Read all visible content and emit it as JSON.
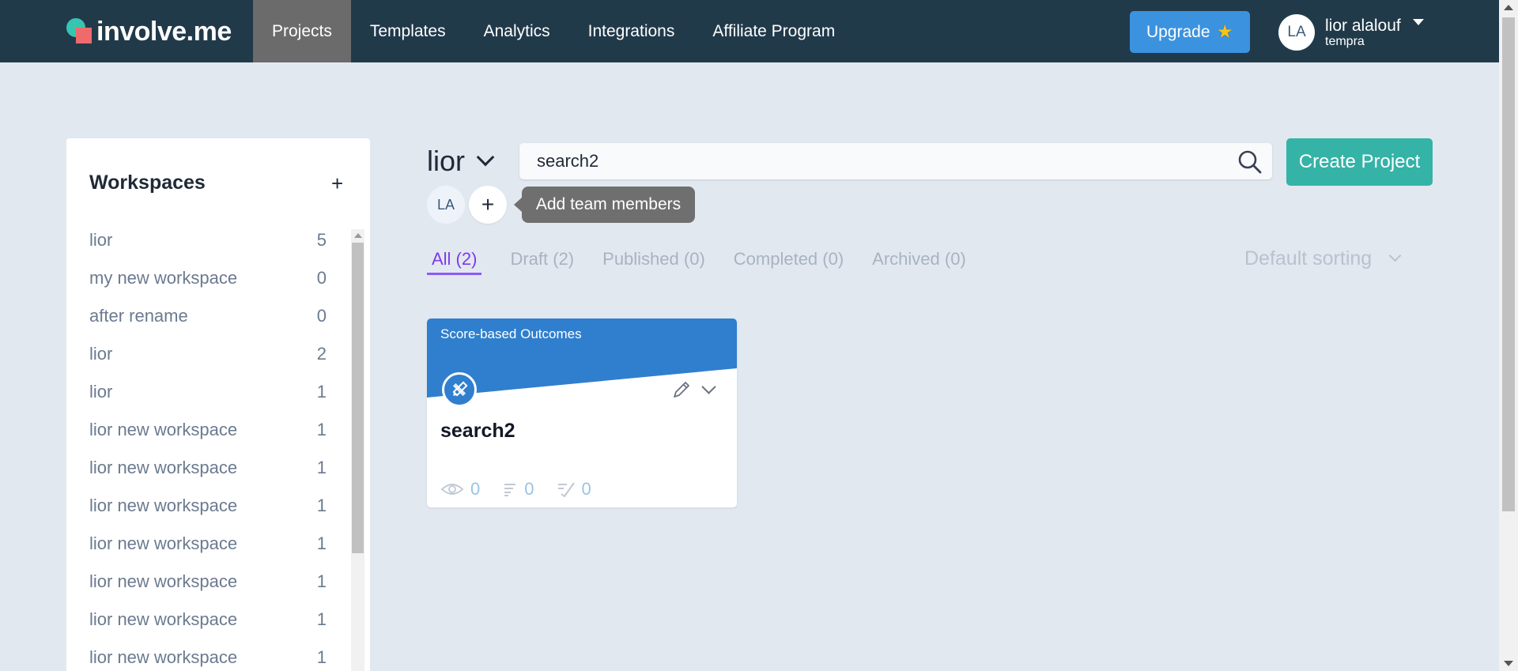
{
  "brand": {
    "name": "involve.me"
  },
  "nav": {
    "items": [
      {
        "label": "Projects",
        "active": true
      },
      {
        "label": "Templates"
      },
      {
        "label": "Analytics"
      },
      {
        "label": "Integrations"
      },
      {
        "label": "Affiliate Program"
      }
    ],
    "upgrade_label": "Upgrade",
    "user": {
      "initials": "LA",
      "name": "lior alalouf",
      "org": "tempra"
    }
  },
  "sidebar": {
    "title": "Workspaces",
    "add_label": "+",
    "items": [
      {
        "label": "lior",
        "count": "5"
      },
      {
        "label": "my new workspace",
        "count": "0"
      },
      {
        "label": "after rename",
        "count": "0"
      },
      {
        "label": "lior",
        "count": "2"
      },
      {
        "label": "lior",
        "count": "1"
      },
      {
        "label": "lior new workspace",
        "count": "1"
      },
      {
        "label": "lior new workspace",
        "count": "1"
      },
      {
        "label": "lior new workspace",
        "count": "1"
      },
      {
        "label": "lior new workspace",
        "count": "1"
      },
      {
        "label": "lior new workspace",
        "count": "1"
      },
      {
        "label": "lior new workspace",
        "count": "1"
      },
      {
        "label": "lior new workspace",
        "count": "1"
      }
    ]
  },
  "main": {
    "workspace_name": "lior",
    "search": {
      "value": "search2",
      "placeholder": ""
    },
    "create_label": "Create Project",
    "member_initials": "LA",
    "add_member_label": "+",
    "tooltip": "Add team members",
    "tabs": [
      {
        "label": "All (2)",
        "active": true
      },
      {
        "label": "Draft (2)"
      },
      {
        "label": "Published (0)"
      },
      {
        "label": "Completed (0)"
      },
      {
        "label": "Archived (0)"
      }
    ],
    "sort_label": "Default sorting",
    "projects": [
      {
        "type": "Score-based Outcomes",
        "title": "search2",
        "views": "0",
        "submissions": "0",
        "completions": "0",
        "banner_color": "#2f7fce"
      }
    ]
  },
  "colors": {
    "nav_bg": "#213a4a",
    "accent_teal": "#35b3a7",
    "upgrade_blue": "#3b93e0",
    "tab_active": "#7c3aed"
  }
}
